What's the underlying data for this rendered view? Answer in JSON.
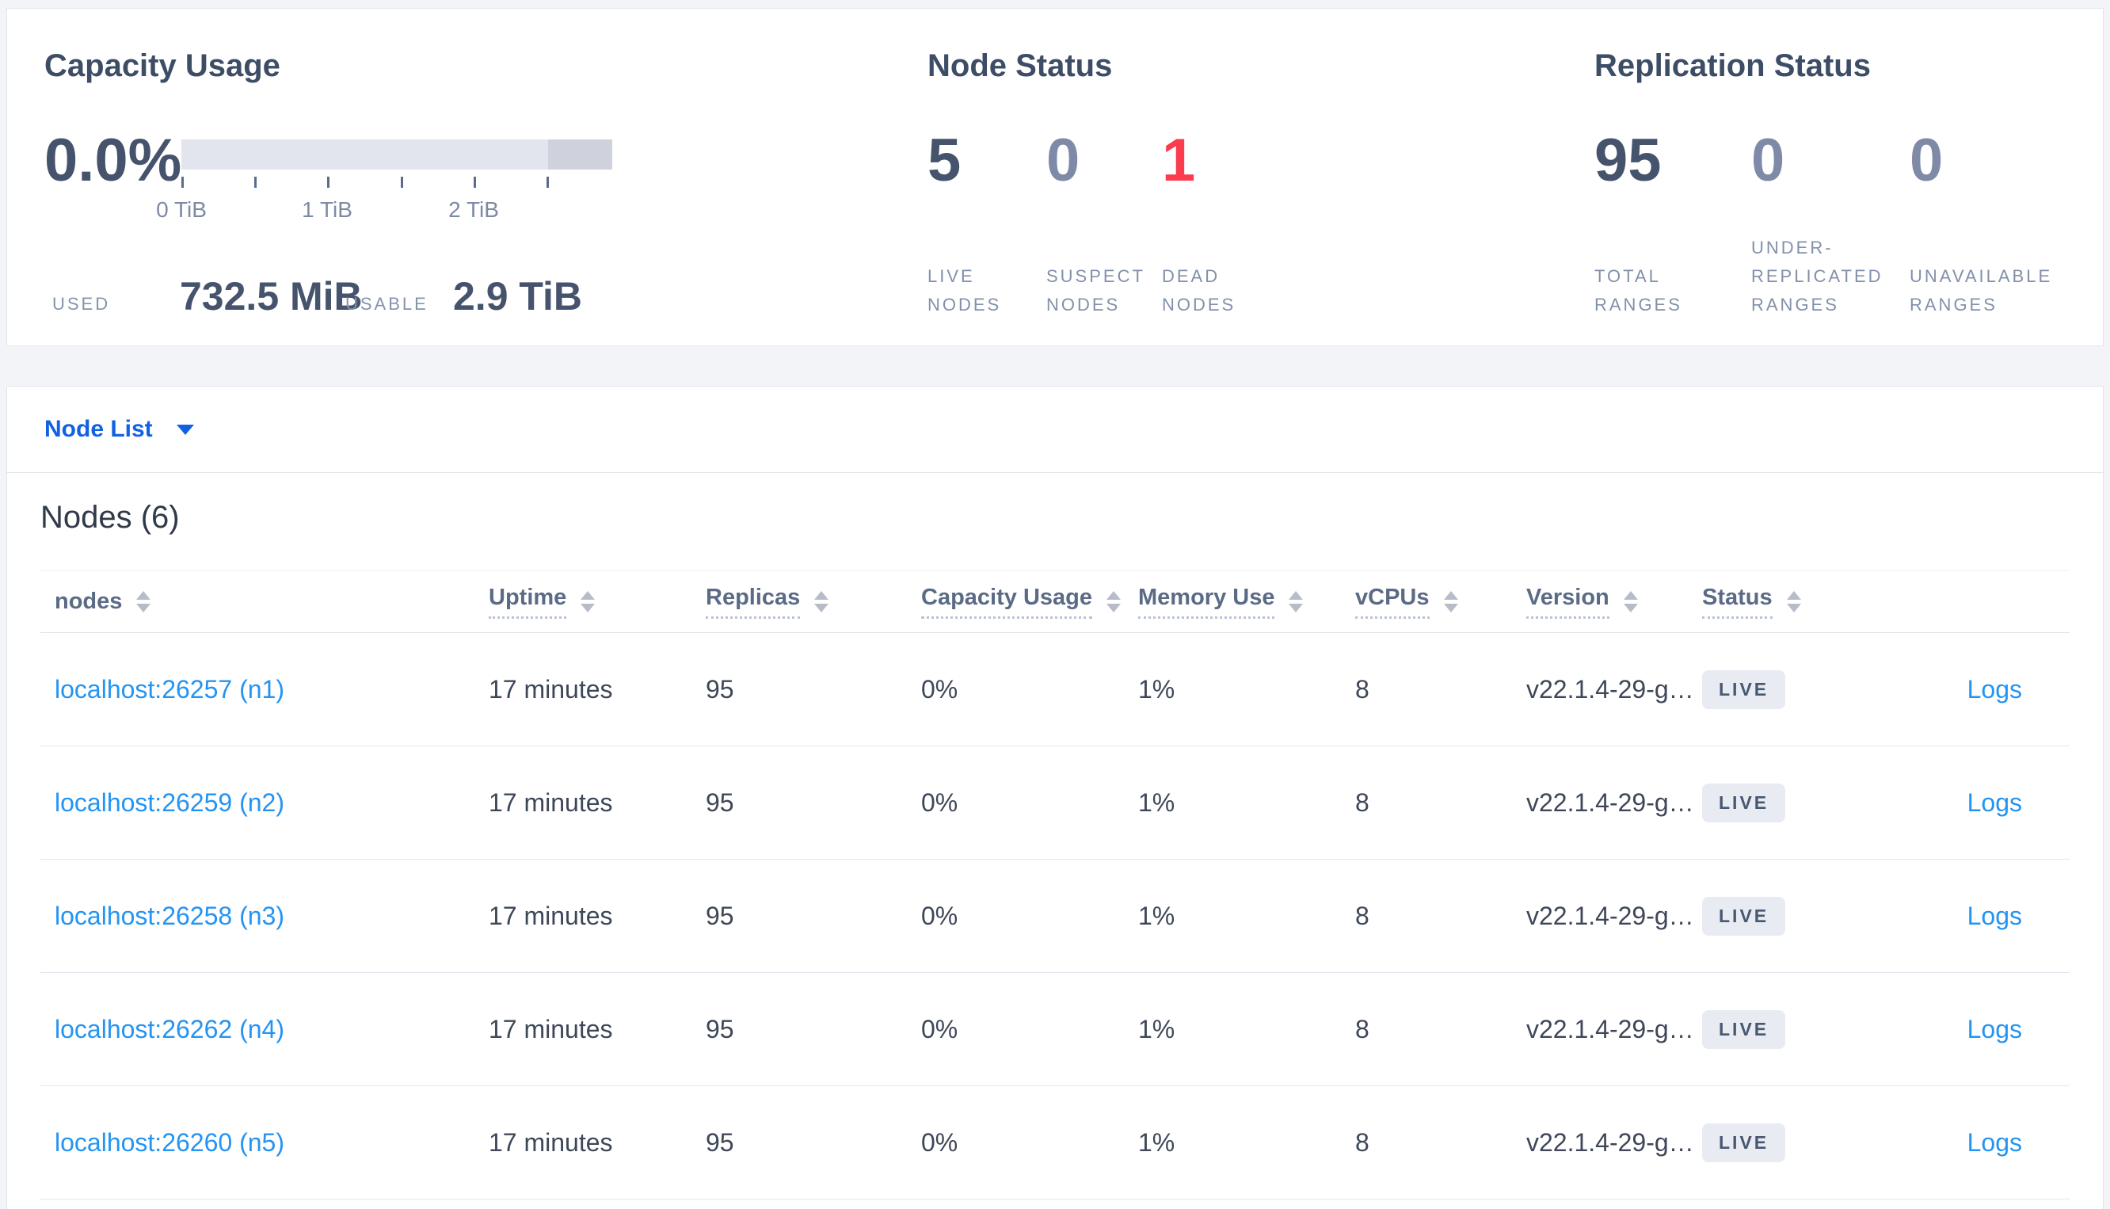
{
  "capacity": {
    "title": "Capacity Usage",
    "percent": "0.0%",
    "tick_labels": [
      "0 TiB",
      "1 TiB",
      "2 TiB"
    ],
    "used_label": "USED",
    "used_value": "732.5 MiB",
    "usable_label": "USABLE",
    "usable_value": "2.9 TiB"
  },
  "node_status": {
    "title": "Node Status",
    "stats": [
      {
        "value": "5",
        "label": "LIVE NODES",
        "tone": "dark"
      },
      {
        "value": "0",
        "label": "SUSPECT NODES",
        "tone": "muted"
      },
      {
        "value": "1",
        "label": "DEAD NODES",
        "tone": "red"
      }
    ]
  },
  "replication": {
    "title": "Replication Status",
    "stats": [
      {
        "value": "95",
        "label": "TOTAL RANGES",
        "tone": "dark"
      },
      {
        "value": "0",
        "label": "UNDER-REPLICATED RANGES",
        "tone": "muted"
      },
      {
        "value": "0",
        "label": "UNAVAILABLE RANGES",
        "tone": "muted"
      }
    ]
  },
  "view_switcher": {
    "label": "Node List"
  },
  "table": {
    "heading": "Nodes (6)",
    "columns": [
      {
        "label": "nodes",
        "underline": false
      },
      {
        "label": "Uptime",
        "underline": true
      },
      {
        "label": "Replicas",
        "underline": true
      },
      {
        "label": "Capacity Usage",
        "underline": true
      },
      {
        "label": "Memory Use",
        "underline": true
      },
      {
        "label": "vCPUs",
        "underline": true
      },
      {
        "label": "Version",
        "underline": true
      },
      {
        "label": "Status",
        "underline": true
      }
    ],
    "rows": [
      {
        "address": "localhost:26257 (n1)",
        "uptime": "17 minutes",
        "replicas": "95",
        "capacity": "0%",
        "memory": "1%",
        "vcpus": "8",
        "version": "v22.1.4-29-g…",
        "status": "LIVE",
        "logs": "Logs"
      },
      {
        "address": "localhost:26259 (n2)",
        "uptime": "17 minutes",
        "replicas": "95",
        "capacity": "0%",
        "memory": "1%",
        "vcpus": "8",
        "version": "v22.1.4-29-g…",
        "status": "LIVE",
        "logs": "Logs"
      },
      {
        "address": "localhost:26258 (n3)",
        "uptime": "17 minutes",
        "replicas": "95",
        "capacity": "0%",
        "memory": "1%",
        "vcpus": "8",
        "version": "v22.1.4-29-g…",
        "status": "LIVE",
        "logs": "Logs"
      },
      {
        "address": "localhost:26262 (n4)",
        "uptime": "17 minutes",
        "replicas": "95",
        "capacity": "0%",
        "memory": "1%",
        "vcpus": "8",
        "version": "v22.1.4-29-g…",
        "status": "LIVE",
        "logs": "Logs"
      },
      {
        "address": "localhost:26260 (n5)",
        "uptime": "17 minutes",
        "replicas": "95",
        "capacity": "0%",
        "memory": "1%",
        "vcpus": "8",
        "version": "v22.1.4-29-g…",
        "status": "LIVE",
        "logs": "Logs"
      }
    ]
  },
  "colors": {
    "accent_blue": "#1261e2",
    "link_blue": "#2494f2",
    "dead_red": "#fb3b4e",
    "stat_dark": "#46536c",
    "stat_muted": "#7e8aa8"
  }
}
